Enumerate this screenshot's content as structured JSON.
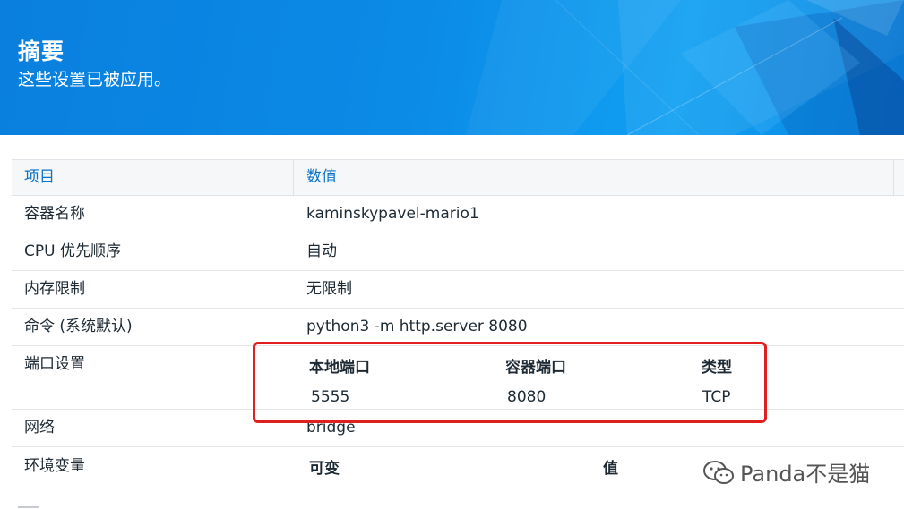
{
  "header": {
    "title": "摘要",
    "subtitle": "这些设置已被应用。"
  },
  "table": {
    "columns": [
      "项目",
      "数值"
    ],
    "rows": [
      {
        "item": "容器名称",
        "value": "kaminskypavel-mario1"
      },
      {
        "item": "CPU 优先顺序",
        "value": "自动"
      },
      {
        "item": "内存限制",
        "value": "无限制"
      },
      {
        "item": "命令 (系统默认)",
        "value": "python3 -m http.server 8080"
      }
    ],
    "ports": {
      "item": "端口设置",
      "headers": [
        "本地端口",
        "容器端口",
        "类型"
      ],
      "values": [
        "5555",
        "8080",
        "TCP"
      ]
    },
    "network": {
      "item": "网络",
      "value": "bridge"
    },
    "env": {
      "item": "环境变量",
      "headers": [
        "可变",
        "值"
      ]
    }
  },
  "watermark": {
    "icon": "wechat-icon",
    "text": "Panda不是猫"
  },
  "colors": {
    "header_blue": "#0a7fde",
    "link_blue": "#0b72c9",
    "highlight_red": "#e0201f"
  }
}
